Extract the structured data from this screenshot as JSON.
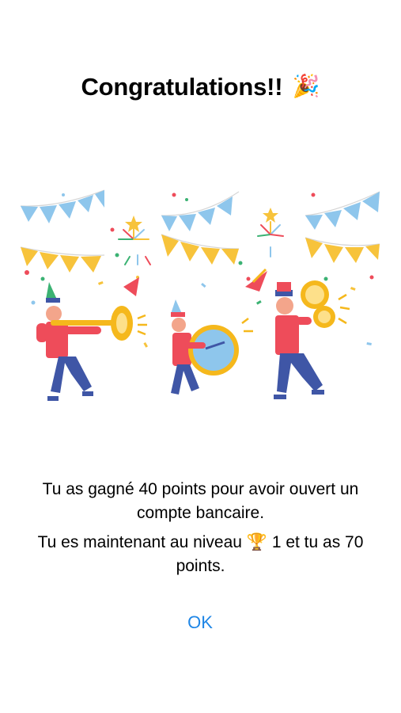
{
  "dialog": {
    "title": "Congratulations!!",
    "title_emoji": "🎉",
    "message_line1": "Tu as gagné 40 points pour avoir ouvert un compte bancaire.",
    "message_level_prefix": "Tu es maintenant au niveau",
    "trophy_glyph": "🏆",
    "message_level_suffix": "1 et tu as 70 points.",
    "ok_label": "OK"
  },
  "colors": {
    "accent": "#1f86e6",
    "bunting_blue": "#8ec6ec",
    "bunting_yellow": "#f7c33b",
    "uniform_red": "#ee4c5a",
    "trousers_navy": "#3f56a6",
    "brass": "#f5b81c"
  },
  "icons": {
    "celebration": "party-popper-icon",
    "level": "trophy-icon",
    "illustration": "marching-band-illustration"
  }
}
